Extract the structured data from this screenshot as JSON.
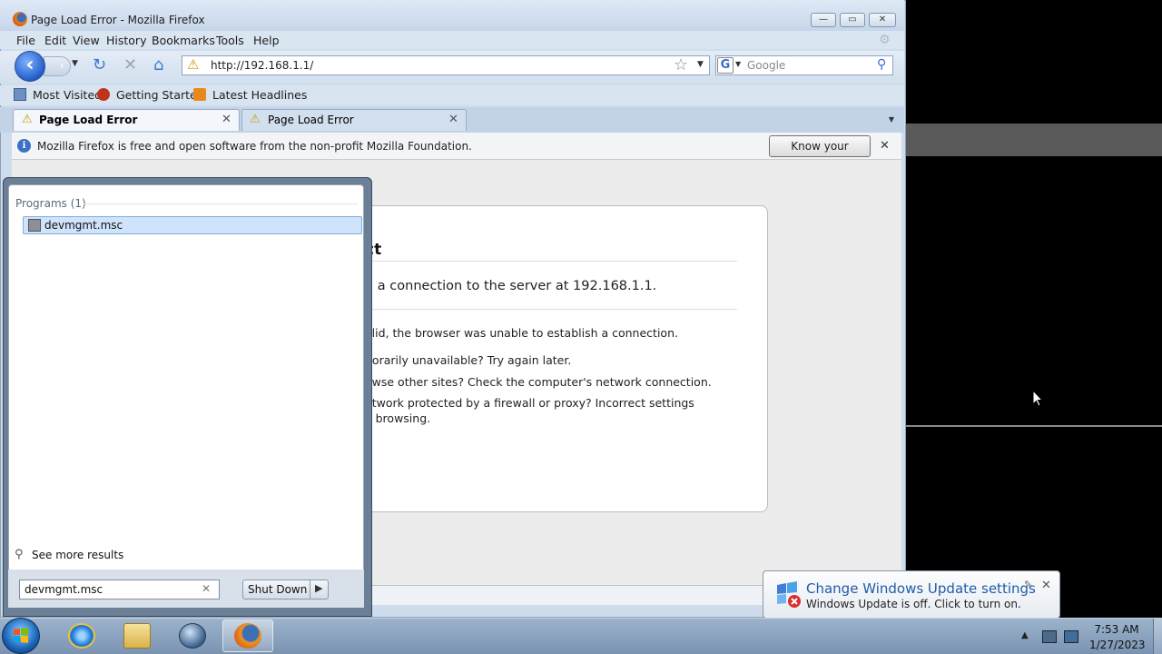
{
  "window": {
    "title": "Page Load Error - Mozilla Firefox"
  },
  "menu": [
    "File",
    "Edit",
    "View",
    "History",
    "Bookmarks",
    "Tools",
    "Help"
  ],
  "nav": {
    "url": "http://192.168.1.1/",
    "search_placeholder": "Google",
    "search_engine_icon": "G"
  },
  "bookmarks": [
    "Most Visited",
    "Getting Started",
    "Latest Headlines"
  ],
  "tabs": [
    {
      "label": "Page Load Error",
      "active": true
    },
    {
      "label": "Page Load Error",
      "active": false
    }
  ],
  "notification": {
    "text": "Mozilla Firefox is free and open software from the non-profit Mozilla Foundation.",
    "button": "Know your rights..."
  },
  "error_page": {
    "title_fragment": "ct",
    "lead": "n a connection to the server at 192.168.1.1.",
    "items": [
      "alid, the browser was unable to establish a connection.",
      "porarily unavailable? Try again later.",
      "owse other sites? Check the computer's network connection.",
      "etwork protected by a firewall or proxy? Incorrect settings",
      "o browsing."
    ]
  },
  "start_menu": {
    "group_header": "Programs (1)",
    "result": "devmgmt.msc",
    "see_more": "See more results",
    "search_value": "devmgmt.msc",
    "shutdown": "Shut Down"
  },
  "balloon": {
    "title": "Change Windows Update settings",
    "body": "Windows Update is off. Click to turn on."
  },
  "clock": {
    "time": "7:53 AM",
    "date": "1/27/2023"
  },
  "colors": {
    "accent": "#1f5ca8",
    "selection": "#cfe4fb",
    "taskbar": "#8aa3c0"
  }
}
